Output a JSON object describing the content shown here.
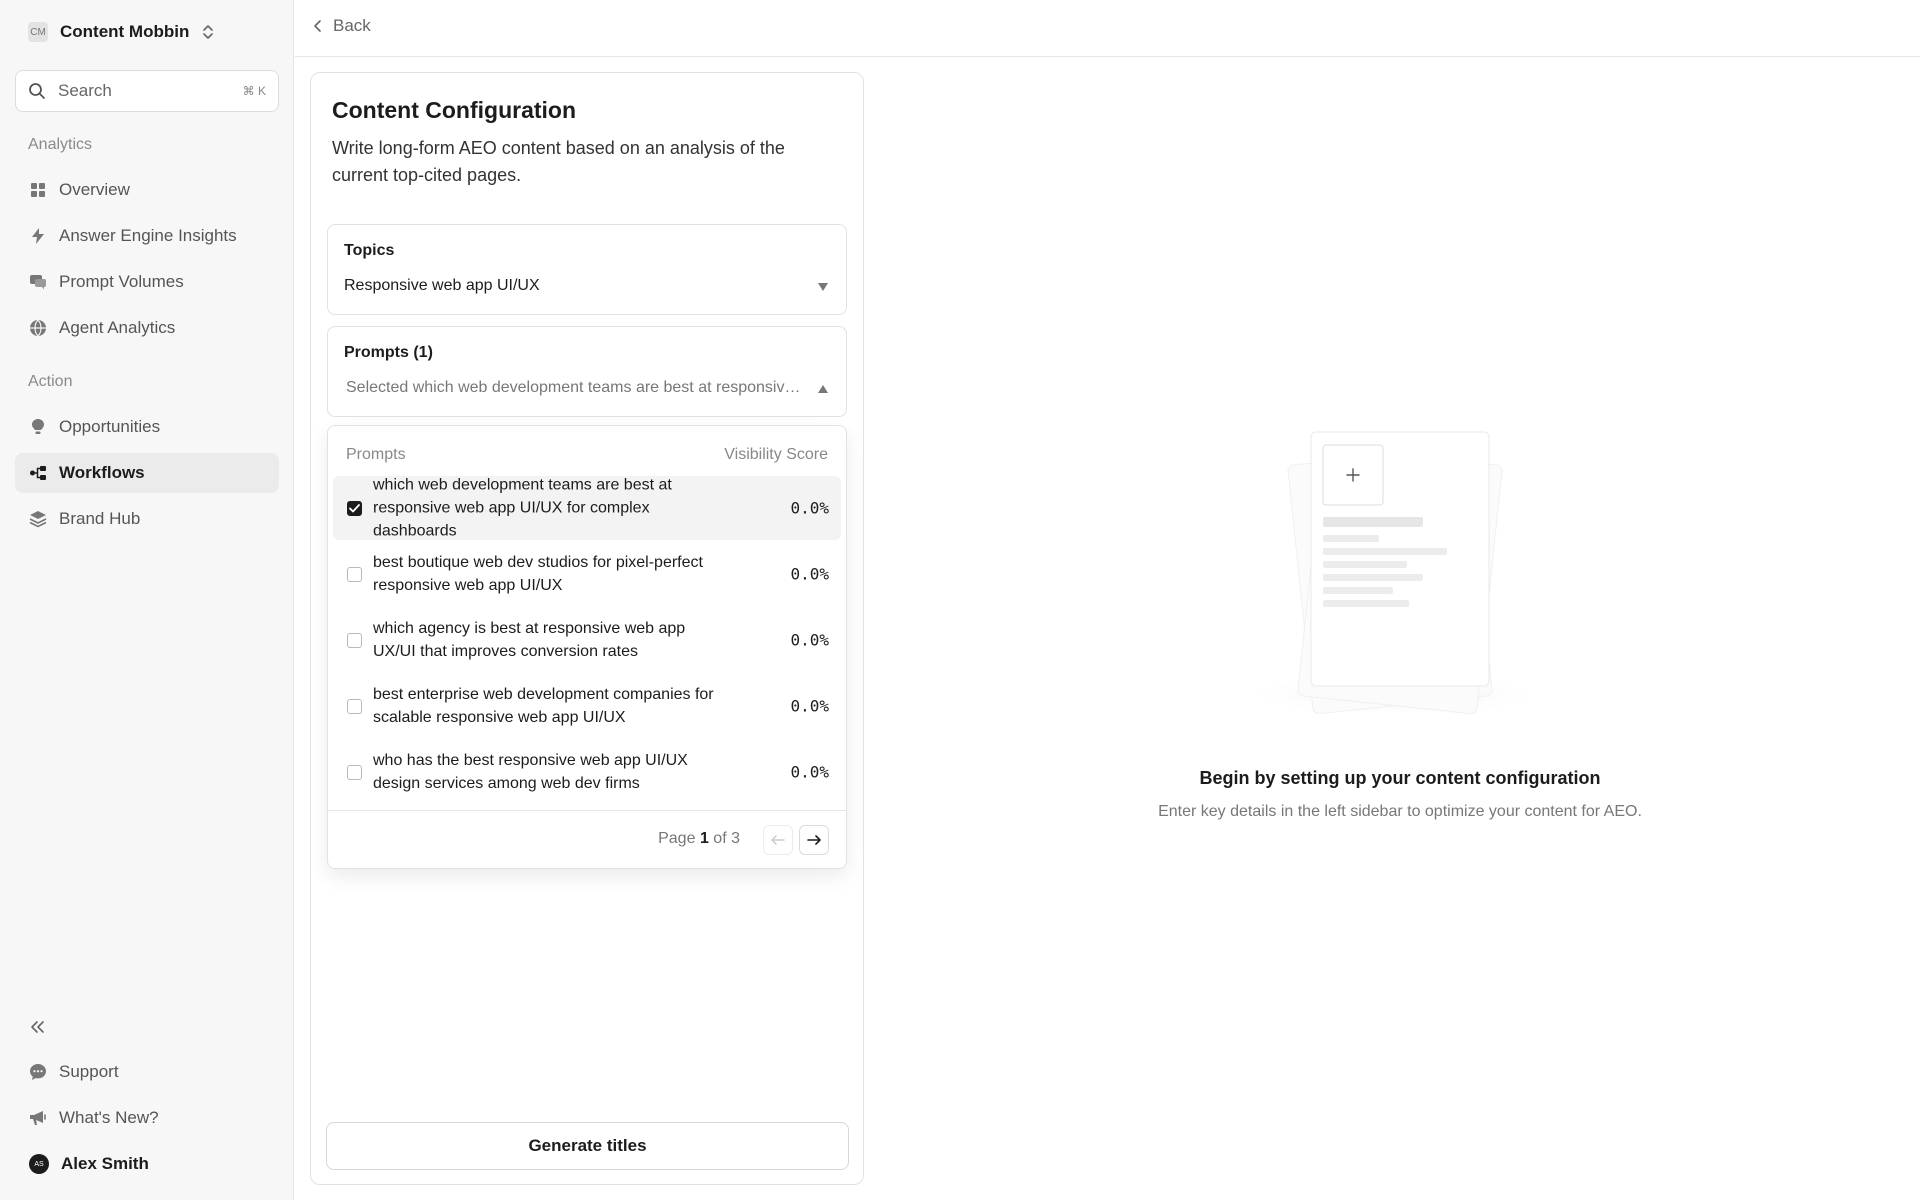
{
  "workspace": {
    "initials": "CM",
    "name": "Content Mobbin"
  },
  "search": {
    "label": "Search",
    "shortcut": "⌘ K"
  },
  "sidebar": {
    "analytics_label": "Analytics",
    "analytics_items": [
      {
        "label": "Overview",
        "icon": "grid-icon"
      },
      {
        "label": "Answer Engine Insights",
        "icon": "bolt-icon"
      },
      {
        "label": "Prompt Volumes",
        "icon": "chat-icon"
      },
      {
        "label": "Agent Analytics",
        "icon": "globe-icon"
      }
    ],
    "action_label": "Action",
    "action_items": [
      {
        "label": "Opportunities",
        "icon": "lightbulb-icon"
      },
      {
        "label": "Workflows",
        "icon": "workflow-icon",
        "active": true
      },
      {
        "label": "Brand Hub",
        "icon": "layers-icon"
      }
    ],
    "footer_items": [
      {
        "label": "Support",
        "icon": "support-icon"
      },
      {
        "label": "What's New?",
        "icon": "megaphone-icon"
      }
    ],
    "user": {
      "initials": "AS",
      "name": "Alex Smith"
    }
  },
  "topbar": {
    "back_label": "Back"
  },
  "config": {
    "title": "Content Configuration",
    "description": "Write long-form AEO content based on an analysis of the current top-cited pages.",
    "topics": {
      "label": "Topics",
      "value": "Responsive web app UI/UX"
    },
    "prompts": {
      "label": "Prompts (1)",
      "value": "Selected which web development teams are best at responsive web app UI/UX for complex dashboards"
    },
    "dropdown": {
      "col_prompts": "Prompts",
      "col_score": "Visibility Score",
      "rows": [
        {
          "text": "which web development teams are best at responsive web app UI/UX for complex dashboards",
          "score": "0.0%",
          "checked": true
        },
        {
          "text": "best boutique web dev studios for pixel-perfect responsive web app UI/UX",
          "score": "0.0%",
          "checked": false
        },
        {
          "text": "which agency is best at responsive web app UX/UI that improves conversion rates",
          "score": "0.0%",
          "checked": false
        },
        {
          "text": "best enterprise web development companies for scalable responsive web app UI/UX",
          "score": "0.0%",
          "checked": false
        },
        {
          "text": "who has the best responsive web app UI/UX design services among web dev firms",
          "score": "0.0%",
          "checked": false
        }
      ],
      "pager": {
        "prefix": "Page",
        "current": "1",
        "middle": "of",
        "total": "3"
      }
    },
    "generate_label": "Generate titles"
  },
  "empty_state": {
    "title": "Begin by setting up your content configuration",
    "subtitle": "Enter key details in the left sidebar to optimize your content for AEO."
  },
  "colors": {
    "accent": "#1c1c1c",
    "sidebar_bg": "#f7f7f7",
    "border": "#e2e2e2"
  }
}
